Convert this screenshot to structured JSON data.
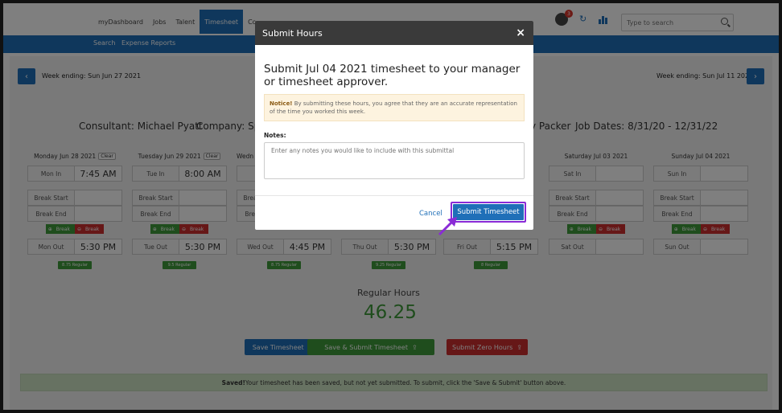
{
  "nav": {
    "items": [
      "myDashboard",
      "Jobs",
      "Talent",
      "Timesheet",
      "Co"
    ],
    "active_index": 3,
    "notification_count": "3",
    "search_placeholder": "Type to search"
  },
  "subnav": {
    "items": [
      "Search",
      "Expense Reports"
    ]
  },
  "week": {
    "prev_label": "Week ending: Sun Jun 27 2021",
    "next_label": "Week ending: Sun Jul 11 2021",
    "prev_icon": "chevron-left-icon",
    "next_icon": "chevron-right-icon"
  },
  "info": {
    "consultant": "Consultant: Michael Pyatt",
    "company": "Company: Sp",
    "client_tail": "y Packer",
    "job_dates": "Job Dates: 8/31/20 - 12/31/22"
  },
  "labels": {
    "break_start": "Break Start",
    "break_end": "Break End",
    "add_break": "Break",
    "remove_break": "Break",
    "clear": "Clear"
  },
  "days": [
    {
      "header": "Monday Jun 28 2021",
      "has_clear": true,
      "in_label": "Mon In",
      "in_val": "7:45 AM",
      "out_label": "Mon Out",
      "out_val": "5:30 PM",
      "tag": "8.75 Regular",
      "has_breaks": true
    },
    {
      "header": "Tuesday Jun 29 2021",
      "has_clear": true,
      "in_label": "Tue In",
      "in_val": "8:00 AM",
      "out_label": "Tue Out",
      "out_val": "5:30 PM",
      "tag": "9.5 Regular",
      "has_breaks": true
    },
    {
      "header": "Wedn",
      "has_clear": false,
      "in_label": "",
      "in_val": "",
      "out_label": "Wed Out",
      "out_val": "4:45 PM",
      "tag": "8.75 Regular",
      "has_breaks": false
    },
    {
      "header": "",
      "has_clear": false,
      "in_label": "",
      "in_val": "",
      "out_label": "Thu Out",
      "out_val": "5:30 PM",
      "tag": "9.25 Regular",
      "has_breaks": false
    },
    {
      "header": "",
      "has_clear": false,
      "in_label": "",
      "in_val": "",
      "out_label": "Fri Out",
      "out_val": "5:15 PM",
      "tag": "8 Regular",
      "has_breaks": false
    },
    {
      "header": "Saturday Jul 03 2021",
      "has_clear": false,
      "in_label": "Sat In",
      "in_val": "",
      "out_label": "Sat Out",
      "out_val": "",
      "tag": "",
      "has_breaks": true
    },
    {
      "header": "Sunday Jul 04 2021",
      "has_clear": false,
      "in_label": "Sun In",
      "in_val": "",
      "out_label": "Sun Out",
      "out_val": "",
      "tag": "",
      "has_breaks": true
    }
  ],
  "summary": {
    "title": "Regular Hours",
    "value": "46.25"
  },
  "actions": {
    "save": "Save Timesheet",
    "save_submit": "Save & Submit Timesheet",
    "submit_zero": "Submit Zero Hours"
  },
  "banner": {
    "strong": "Saved!",
    "text": " Your timesheet has been saved, but not yet submitted. To submit, click the 'Save & Submit' button above."
  },
  "modal": {
    "title": "Submit Hours",
    "close": "×",
    "heading": "Submit Jul 04 2021 timesheet to your manager or timesheet approver.",
    "notice_strong": "Notice!",
    "notice_text": " By submitting these hours, you agree that they are an accurate representation of the time you worked this week.",
    "notes_label": "Notes:",
    "notes_placeholder": "Enter any notes you would like to include with this submittal",
    "cancel": "Cancel",
    "submit": "Submit Timesheet"
  },
  "colors": {
    "primary": "#1f6fb8",
    "success": "#3f9a3a",
    "danger": "#cc2f2f",
    "highlight": "#8a2bd6"
  }
}
